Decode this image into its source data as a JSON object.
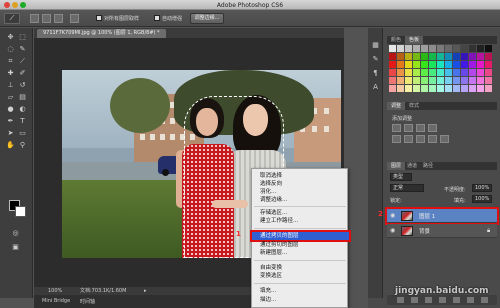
{
  "window": {
    "app_title": "Adobe Photoshop CS6"
  },
  "options_bar": {
    "tool_glyph": "⟋",
    "checkbox1_label": "对所有图层取样",
    "checkbox2_label": "自动增强",
    "refine_button": "调整边缘..."
  },
  "document": {
    "tab_label": "9711F7K709MI.jpg @ 100% (图层 1, RGB/8#) *",
    "zoom": "100%",
    "doc_info": "文档:703.1K/1.60M",
    "bottom_tabs": [
      "Mini Bridge",
      "时间轴"
    ]
  },
  "annotations": {
    "step1": "1",
    "step2": "2"
  },
  "context_menu": {
    "items": [
      "取消选择",
      "选择反向",
      "羽化...",
      "调整边缘...",
      "存储选区...",
      "建立工作路径...",
      "通过拷贝的图层",
      "通过剪切的图层",
      "新建图层...",
      "自由变换",
      "变换选区",
      "填充...",
      "描边..."
    ],
    "highlighted": "通过拷贝的图层"
  },
  "right_panel": {
    "color_tabs": [
      "颜色",
      "色板"
    ],
    "adjust_tabs": [
      "调整",
      "样式"
    ],
    "adjust_title": "添加调整",
    "layers_tabs": [
      "图层",
      "通道",
      "路径"
    ],
    "kind_label": "类型",
    "blend_mode": "正常",
    "opacity_label": "不透明度:",
    "opacity_value": "100%",
    "lock_label": "锁定:",
    "fill_label": "填充:",
    "fill_value": "100%",
    "layers": [
      {
        "name": "图层 1",
        "selected": true
      },
      {
        "name": "背景",
        "selected": false
      }
    ]
  },
  "colors": {
    "accent_highlight": "#2f5fd0",
    "annotation_red": "#e01010"
  },
  "watermark": "jingyan.baidu.com"
}
